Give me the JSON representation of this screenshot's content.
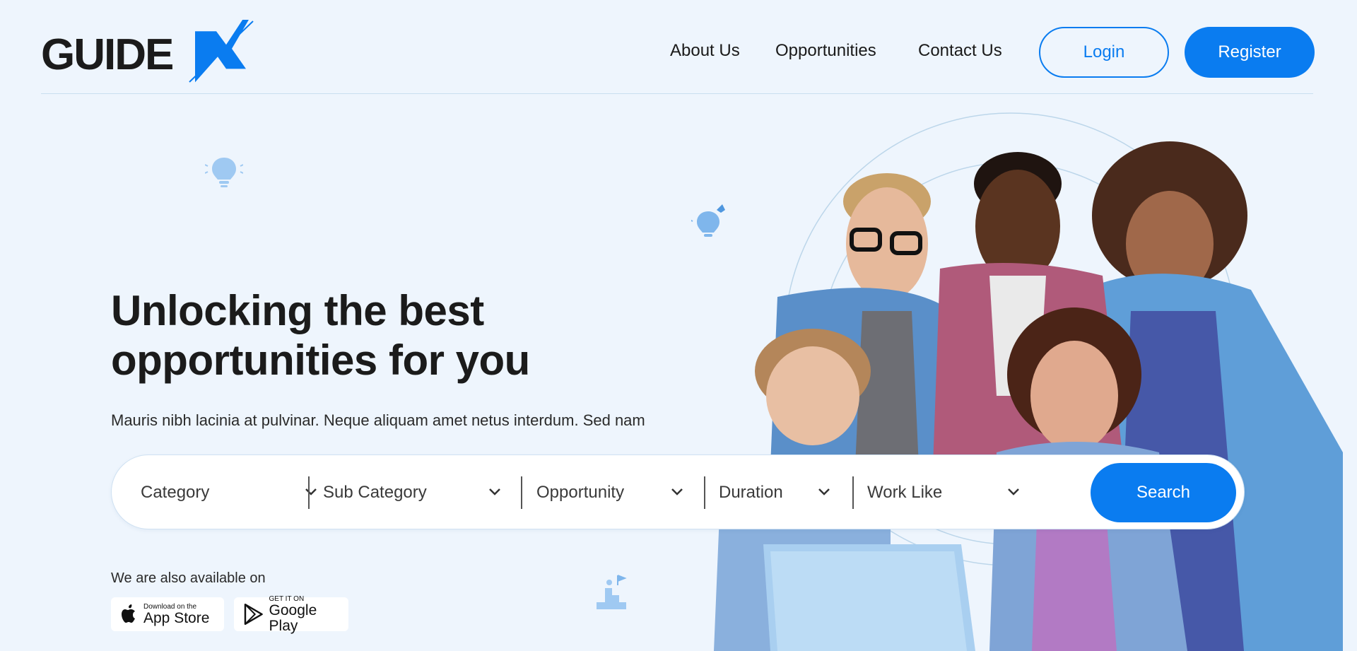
{
  "brand": {
    "logo_text_main": "GUIDE",
    "logo_text_accent": "X",
    "accent_color": "#0a7cf0"
  },
  "nav": {
    "items": [
      {
        "label": "About Us"
      },
      {
        "label": "Opportunities"
      },
      {
        "label": "Contact Us"
      }
    ],
    "login_label": "Login",
    "register_label": "Register"
  },
  "hero": {
    "title": "Unlocking the best opportunities for you",
    "subtitle": "Mauris nibh lacinia at pulvinar. Neque aliquam amet netus interdum. Sed nam"
  },
  "search": {
    "filters": [
      {
        "label": "Category",
        "icon": "chevron-down-icon"
      },
      {
        "label": "Sub Category",
        "icon": "chevron-down-icon"
      },
      {
        "label": "Opportunity",
        "icon": "chevron-down-icon"
      },
      {
        "label": "Duration",
        "icon": "chevron-down-icon"
      },
      {
        "label": "Work Like",
        "icon": "chevron-down-icon"
      }
    ],
    "button_label": "Search"
  },
  "availability": {
    "label": "We are also available on",
    "app_store": {
      "small": "Download on the",
      "big": "App Store",
      "icon": "apple-icon"
    },
    "google_play": {
      "small": "GET IT ON",
      "big": "Google Play",
      "icon": "play-icon"
    }
  },
  "decorations": [
    "lightbulb-brain-icon",
    "lightbulb-idea-icon",
    "climbing-success-icon"
  ],
  "hero_image": "group-of-smiling-students-photo"
}
